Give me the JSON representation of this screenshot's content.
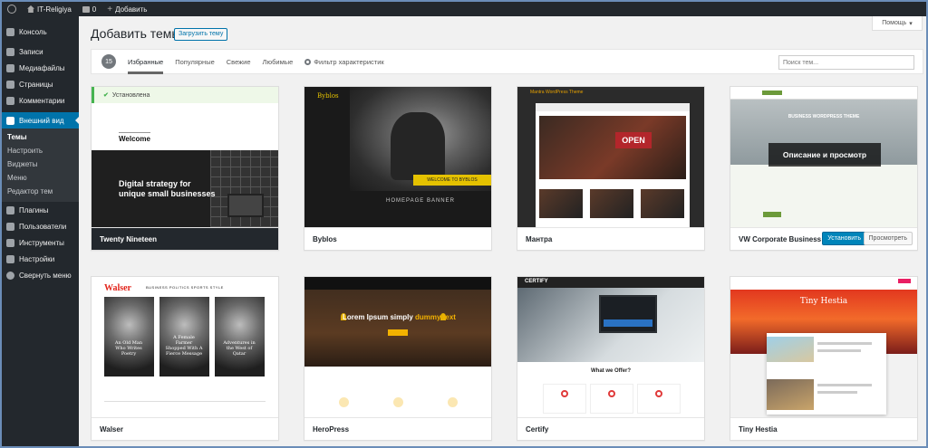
{
  "admin_bar": {
    "site_name": "IT-Religiya",
    "comments_count": "0",
    "add_new": "Добавить"
  },
  "sidebar": {
    "items": [
      {
        "label": "Консоль"
      },
      {
        "label": "Записи"
      },
      {
        "label": "Медиафайлы"
      },
      {
        "label": "Страницы"
      },
      {
        "label": "Комментарии"
      },
      {
        "label": "Внешний вид"
      }
    ],
    "submenu": [
      "Темы",
      "Настроить",
      "Виджеты",
      "Меню",
      "Редактор тем"
    ],
    "items2": [
      {
        "label": "Плагины"
      },
      {
        "label": "Пользователи"
      },
      {
        "label": "Инструменты"
      },
      {
        "label": "Настройки"
      },
      {
        "label": "Свернуть меню"
      }
    ]
  },
  "header": {
    "help": "Помощь",
    "title": "Добавить темы",
    "upload": "Загрузить тему"
  },
  "filter": {
    "count": "15",
    "tabs": [
      "Избранные",
      "Популярные",
      "Свежие",
      "Любимые"
    ],
    "feature_filter": "Фильтр характеристик",
    "search_placeholder": "Поиск тем..."
  },
  "themes": {
    "twenty_nineteen": {
      "name": "Twenty Nineteen",
      "installed_label": "Установлена",
      "welcome": "Welcome",
      "headline": "Digital strategy for unique small businesses"
    },
    "byblos": {
      "name": "Byblos",
      "logo": "Byblos",
      "cta": "WELCOME TO BYBLOS",
      "banner": "HOMEPAGE BANNER"
    },
    "mantra": {
      "name": "Мантра",
      "header": "Mantra WordPress Theme",
      "sign": "OPEN"
    },
    "vw": {
      "name": "VW Corporate Business",
      "hero": "BUSINESS WORDPRESS THEME",
      "overlay": "Описание и просмотр",
      "install": "Установить",
      "preview": "Просмотреть"
    },
    "walser": {
      "name": "Walser",
      "logo": "Walser",
      "nav": "BUSINESS POLITICS SPORTS STYLE",
      "stories": [
        "An Old Man Who Writes Poetry",
        "A Female Farmer Shopped With A Fierce Message",
        "Adventures in the West of Qatar"
      ]
    },
    "heropress": {
      "name": "HeroPress",
      "headline": "Lorem Ipsum simply",
      "headline_accent": "dummy text"
    },
    "certify": {
      "name": "Certify",
      "logo": "CERTIFY",
      "heading": "What we Offer?"
    },
    "tiny_hestia": {
      "name": "Tiny Hestia",
      "title": "Tiny Hestia"
    }
  }
}
